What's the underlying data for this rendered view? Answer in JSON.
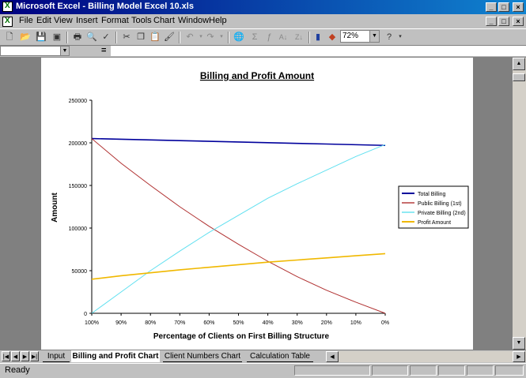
{
  "window": {
    "title": "Microsoft Excel - Billing Model Excel 10.xls"
  },
  "menu": [
    "File",
    "Edit",
    "View",
    "Insert",
    "Format",
    "Tools",
    "Chart",
    "Window",
    "Help"
  ],
  "toolbar": {
    "zoom": "72%"
  },
  "formula": {
    "equals": "="
  },
  "tabs": [
    "Input",
    "Billing and Profit Chart",
    "Client Numbers Chart",
    "Calculation Table"
  ],
  "status": {
    "text": "Ready"
  },
  "colors": {
    "total": "#00009c",
    "public": "#b03030",
    "private": "#60e0f0",
    "profit": "#f0b800"
  },
  "chart_data": {
    "type": "line",
    "title": "Billing and Profit Amount",
    "xlabel": "Percentage of Clients on First Billing Structure",
    "ylabel": "Amount",
    "x": [
      "100%",
      "90%",
      "80%",
      "70%",
      "60%",
      "50%",
      "40%",
      "30%",
      "20%",
      "10%",
      "0%"
    ],
    "ylim": [
      0,
      250000
    ],
    "yticks": [
      "0",
      "50000",
      "100000",
      "150000",
      "200000",
      "250000"
    ],
    "legend": "right",
    "series": [
      {
        "name": "Total Billing",
        "values": [
          205000,
          204200,
          203400,
          202600,
          201800,
          201000,
          200200,
          199400,
          198600,
          197800,
          197000
        ]
      },
      {
        "name": "Public Billing (1st)",
        "values": [
          205000,
          176000,
          150000,
          125000,
          102000,
          81000,
          61000,
          43000,
          27000,
          13000,
          0
        ]
      },
      {
        "name": "Private Billing (2nd)",
        "values": [
          0,
          25000,
          50000,
          73000,
          95000,
          115000,
          135000,
          152000,
          168000,
          184000,
          198000
        ]
      },
      {
        "name": "Profit Amount",
        "values": [
          40000,
          44000,
          47500,
          51000,
          54000,
          57000,
          60000,
          62500,
          65000,
          67500,
          70000
        ]
      }
    ]
  }
}
